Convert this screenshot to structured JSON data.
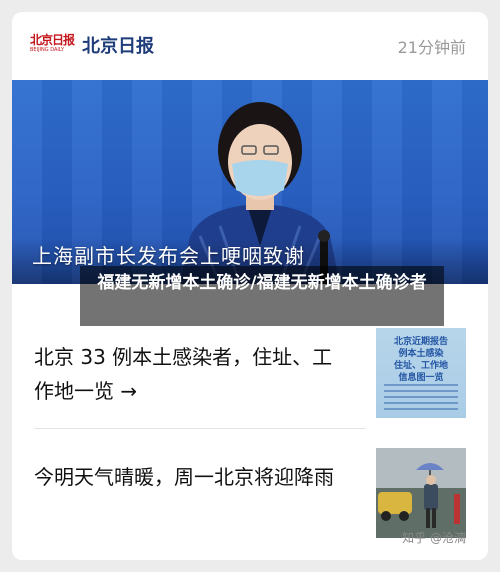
{
  "header": {
    "logo_text": "北京日报",
    "logo_sub": "BEIJING DAILY",
    "source_name": "北京日报",
    "time_ago": "21分钟前"
  },
  "hero": {
    "caption": "上海副市长发布会上哽咽致谢",
    "overlay_title": "福建无新增本土确诊/福建无新增本土确诊者"
  },
  "articles": [
    {
      "title": "北京 33 例本土感染者，住址、工作地一览 →",
      "thumb_text": "北京近期报告\n例本土感染\n住址、工作地\n信息图一览"
    },
    {
      "title": "今明天气晴暖，周一北京将迎降雨"
    }
  ],
  "watermark": "知乎 @沧漓",
  "colors": {
    "brand_red": "#c4161c",
    "source_blue": "#1f3c7a",
    "hero_blue": "#2f6ed0"
  }
}
